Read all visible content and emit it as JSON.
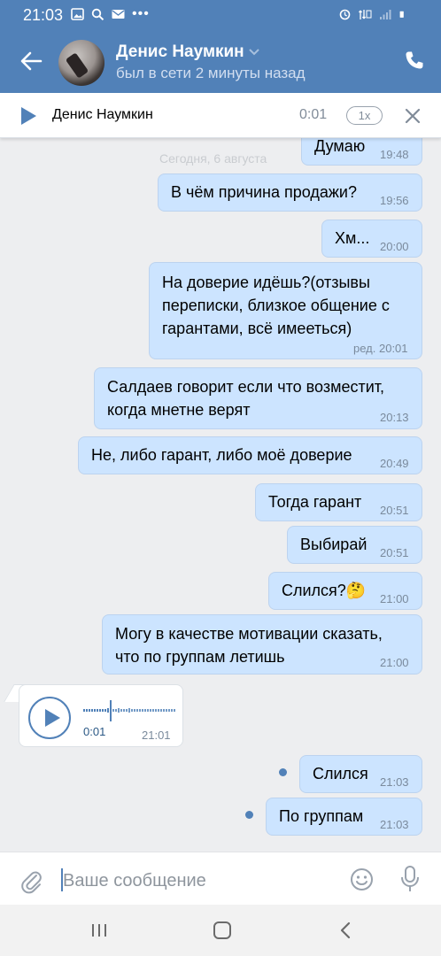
{
  "status_bar": {
    "time": "21:03"
  },
  "header": {
    "name": "Денис Наумкин",
    "status": "был в сети 2 минуты назад"
  },
  "player": {
    "name": "Денис Наумкин",
    "time": "0:01",
    "speed": "1x"
  },
  "chat": {
    "date_separator": "Сегодня, 6 августа",
    "messages": [
      {
        "text": "Думаю",
        "time": "19:48"
      },
      {
        "text": "В чём причина продажи?",
        "time": "19:56"
      },
      {
        "text": "Хм...",
        "time": "20:00"
      },
      {
        "text_lines": [
          "На доверие идёшь?(отзывы",
          "переписки, близкое общение с",
          "гарантами, всё имееться)"
        ],
        "time": "ред. 20:01"
      },
      {
        "text_lines": [
          "Салдаев говорит если что возместит,",
          "когда мнетне верят"
        ],
        "time": "20:13"
      },
      {
        "text": "Не, либо гарант, либо моё доверие",
        "time": "20:49"
      },
      {
        "text": "Тогда гарант",
        "time": "20:51"
      },
      {
        "text": "Выбирай",
        "time": "20:51"
      },
      {
        "text": "Слился?🤔",
        "time": "21:00"
      },
      {
        "text_lines": [
          "Могу в качестве мотивации сказать,",
          "что по группам летишь"
        ],
        "time": "21:00"
      },
      {
        "text": "Слился",
        "time": "21:03"
      },
      {
        "text": "По группам",
        "time": "21:03"
      }
    ],
    "voice": {
      "duration": "0:01",
      "time": "21:01"
    }
  },
  "composer": {
    "placeholder": "Ваше сообщение"
  },
  "colors": {
    "accent": "#5181b8",
    "bubble_out": "#cce4ff",
    "background": "#edeef0"
  }
}
